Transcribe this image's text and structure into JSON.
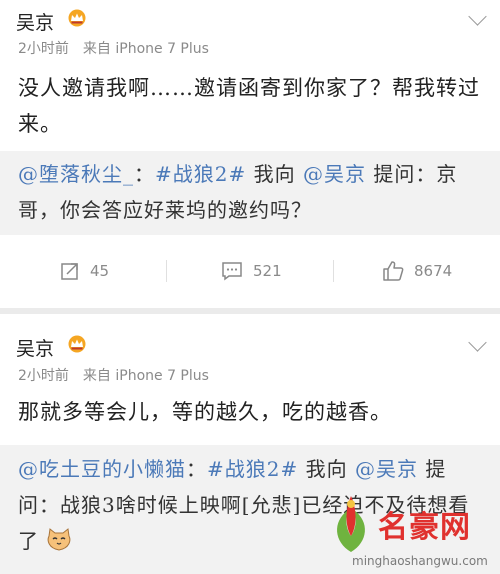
{
  "posts": [
    {
      "author": "吴京",
      "time": "2小时前",
      "source": "来自 iPhone 7 Plus",
      "text": "没人邀请我啊……邀请函寄到你家了？帮我转过来。",
      "repost": {
        "mention": "@堕落秋尘_",
        "sep": "：",
        "hashtag": "#战狼2#",
        "mid": "我向",
        "mention2": "@吴京",
        "tail": "提问：京哥，你会答应好莱坞的邀约吗？"
      },
      "actions": {
        "repost_count": "45",
        "comment_count": "521",
        "like_count": "8674"
      }
    },
    {
      "author": "吴京",
      "time": "2小时前",
      "source": "来自 iPhone 7 Plus",
      "text": "那就多等会儿，等的越久，吃的越香。",
      "repost": {
        "mention": "@吃土豆的小懒猫",
        "sep": "：",
        "hashtag": "#战狼2#",
        "mid": "我向",
        "mention2": "@吴京",
        "tail": "提问：战狼3啥时候上映啊[允悲]已经迫不及待想看了"
      }
    }
  ],
  "watermark": {
    "brand": "名豪网",
    "url": "minghaoshangwu.com"
  },
  "colors": {
    "link": "#4b79b8",
    "meta": "#8a8a8a",
    "vip": "#f5a623",
    "brand": "#e0312e"
  },
  "icons": [
    "vip-crown-icon",
    "chevron-down-icon",
    "repost-icon",
    "comment-icon",
    "like-icon",
    "cat-emoji-icon"
  ]
}
